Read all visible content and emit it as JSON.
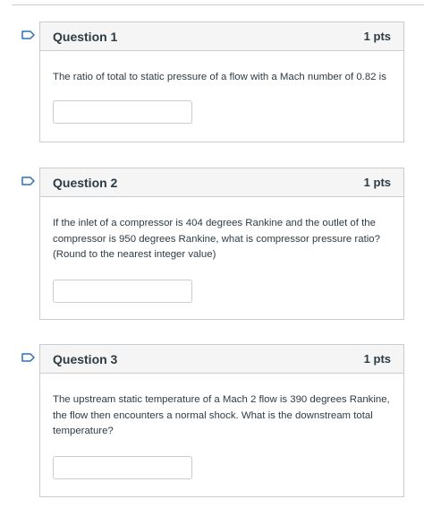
{
  "colors": {
    "flag": "#2d6fb5",
    "border": "#c7cdd1",
    "header_bg": "#f5f5f5",
    "text": "#2d3b45"
  },
  "questions": [
    {
      "title": "Question 1",
      "points": "1 pts",
      "text": "The ratio of total to static pressure of a flow with a Mach number of 0.82 is",
      "answer_value": "",
      "flag_icon": "bookmark-flag-icon"
    },
    {
      "title": "Question 2",
      "points": "1 pts",
      "text": "If the inlet of a compressor is 404 degrees Rankine and the outlet of the compressor is 950 degrees Rankine, what is compressor pressure ratio? (Round to the nearest integer value)",
      "answer_value": "",
      "flag_icon": "bookmark-flag-icon"
    },
    {
      "title": "Question 3",
      "points": "1 pts",
      "text": "The upstream static temperature of a Mach 2 flow is 390 degrees Rankine, the flow then encounters a normal shock. What is the downstream total temperature?",
      "answer_value": "",
      "flag_icon": "bookmark-flag-icon"
    }
  ]
}
